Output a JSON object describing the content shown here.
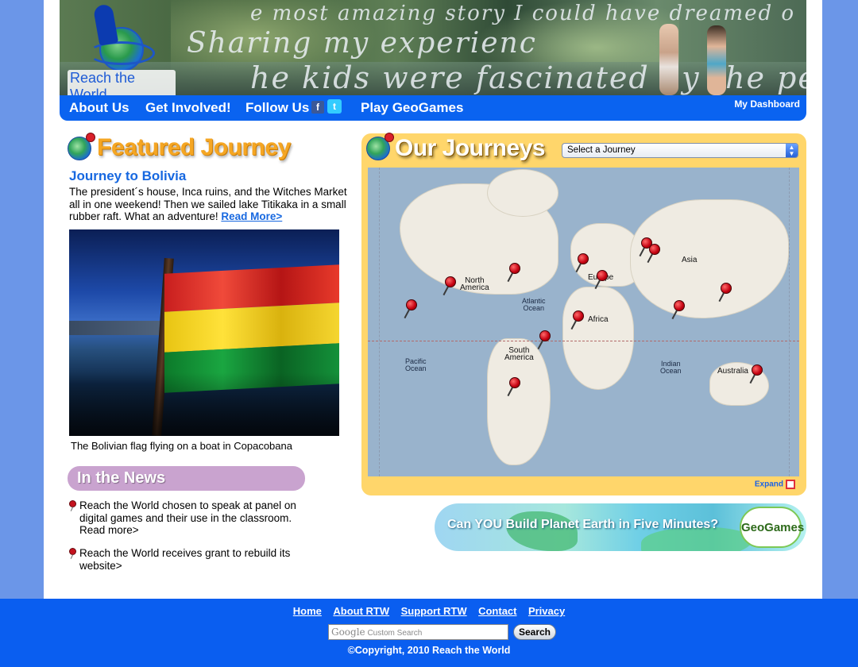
{
  "header": {
    "logo_text": "Reach the World",
    "banner_lines": [
      "e most amazing story I could have dreamed o",
      "Sharing my experienc",
      "he kids were fascinated by the perso"
    ]
  },
  "nav": {
    "items": [
      "About Us",
      "Get Involved!",
      "Follow Us",
      "Play GeoGames"
    ],
    "facebook_icon": "f",
    "twitter_icon": "t",
    "dashboard": "My Dashboard"
  },
  "featured": {
    "heading": "Featured Journey",
    "title": "Journey to Bolivia",
    "text": "The president´s house, Inca ruins, and the Witches Market all in one weekend! Then we sailed lake Titikaka in a small rubber raft. What an adventure! ",
    "read_more": "Read More>",
    "photo_caption": "The Bolivian flag flying on a boat in Copacobana"
  },
  "news": {
    "heading": "In the News",
    "items": [
      "Reach the World chosen to speak at panel on digital games and their use in the classroom. Read more>",
      "Reach the World receives grant to rebuild its website>"
    ]
  },
  "journeys": {
    "heading": "Our Journeys",
    "select_value": "Select a Journey",
    "expand": "Expand",
    "map_labels": {
      "north_america": "North\nAmerica",
      "atlantic": "Atlantic\nOcean",
      "europe": "Europe",
      "asia": "Asia",
      "africa": "Africa",
      "south_america": "South\nAmerica",
      "pacific": "Pacific\nOcean",
      "indian": "Indian\nOcean",
      "australia": "Australia"
    }
  },
  "geogames": {
    "banner_text": "Can YOU Build Planet Earth in Five Minutes?",
    "logo_text": "GeoGames"
  },
  "footer": {
    "links": [
      "Home",
      "About RTW",
      "Support RTW",
      "Contact",
      "Privacy"
    ],
    "search_brand": "Google",
    "search_placeholder": "Custom Search",
    "search_button": "Search",
    "copyright": "©Copyright, 2010 Reach the World"
  },
  "colors": {
    "nav_blue": "#0a63f0",
    "page_bg": "#6b96e8",
    "journeys_panel": "#ffd66b",
    "featured_orange": "#f5a623",
    "news_purple": "#c9a3cf"
  }
}
